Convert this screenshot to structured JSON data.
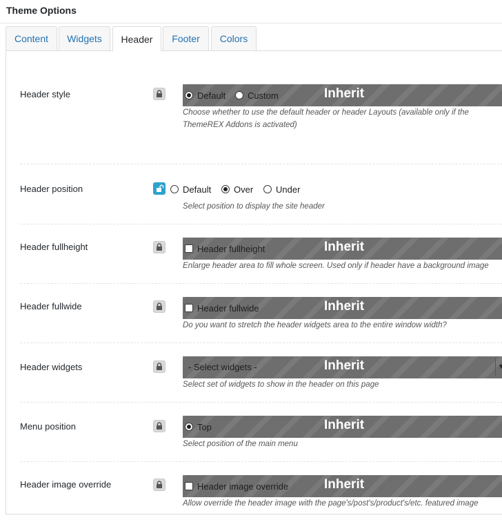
{
  "panel": {
    "title": "Theme Options"
  },
  "tabs": [
    {
      "label": "Content"
    },
    {
      "label": "Widgets"
    },
    {
      "label": "Header"
    },
    {
      "label": "Footer"
    },
    {
      "label": "Colors"
    }
  ],
  "active_tab": "Header",
  "inherit_label": "Inherit",
  "options": {
    "header_style": {
      "label": "Header style",
      "choices": [
        "Default",
        "Custom"
      ],
      "selected": "Default",
      "description": "Choose whether to use the default header or header Layouts (available only if the ThemeREX Addons is activated)"
    },
    "header_position": {
      "label": "Header position",
      "choices": [
        "Default",
        "Over",
        "Under"
      ],
      "selected": "Over",
      "description": "Select position to display the site header"
    },
    "header_fullheight": {
      "label": "Header fullheight",
      "checkbox_label": "Header fullheight",
      "description": "Enlarge header area to fill whole screen. Used only if header have a background image"
    },
    "header_fullwide": {
      "label": "Header fullwide",
      "checkbox_label": "Header fullwide",
      "description": "Do you want to stretch the header widgets area to the entire window width?"
    },
    "header_widgets": {
      "label": "Header widgets",
      "selected": "- Select widgets -",
      "description": "Select set of widgets to show in the header on this page"
    },
    "menu_position": {
      "label": "Menu position",
      "choices": [
        "Top"
      ],
      "selected": "Top",
      "description": "Select position of the main menu"
    },
    "header_image_override": {
      "label": "Header image override",
      "checkbox_label": "Header image override",
      "description": "Allow override the header image with the page's/post's/product's/etc. featured image"
    }
  },
  "colors": {
    "link": "#2271b1",
    "inherit_bar": "#6e6e6e",
    "unlock": "#2ea2cc"
  }
}
